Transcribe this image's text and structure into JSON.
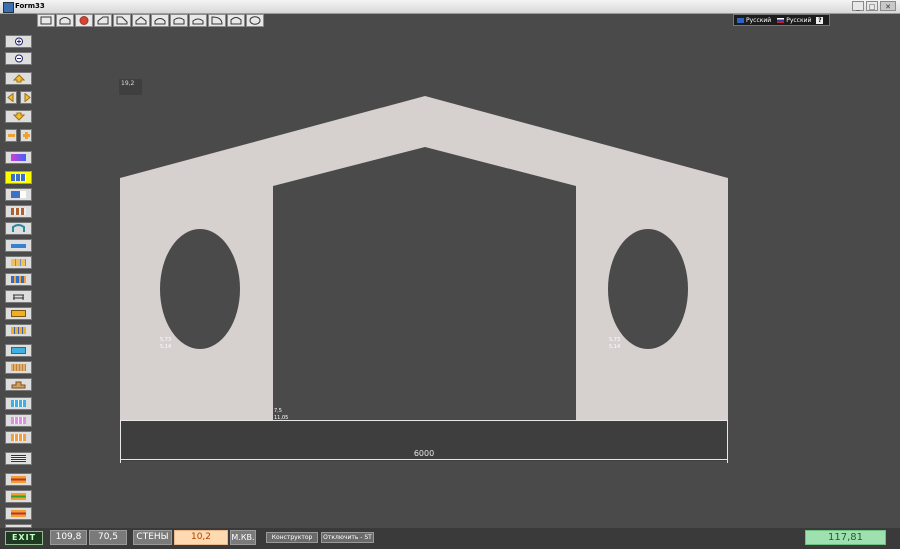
{
  "window": {
    "title": "Form33",
    "min_glyph": "_",
    "max_glyph": "□",
    "close_glyph": "✕"
  },
  "shapes_toolbar": [
    "rect-icon",
    "arch-icon",
    "circle-icon",
    "slope-icon",
    "bevel-icon",
    "peak-icon",
    "arch2-icon",
    "dome-icon",
    "dome2-icon",
    "quarter-icon",
    "dome3-icon",
    "oval-icon"
  ],
  "language": {
    "left": "Русский",
    "right": "Русский",
    "help": "?"
  },
  "canvas": {
    "chip_label": "19,2",
    "left_window_labels": [
      "5,73",
      "5,14"
    ],
    "right_window_labels": [
      "5,73",
      "5,14"
    ],
    "door_labels": [
      "7,5",
      "11,05"
    ],
    "dimension": "6000"
  },
  "statusbar": {
    "exit": "EXIT",
    "coord_x": "109,8",
    "coord_y": "70,5",
    "walls_label": "СТЕНЫ",
    "walls_value": "10,2",
    "unit": "М.КВ.",
    "constructor_button": "Конструктор",
    "disable_button": "Отключить - ST",
    "total": "117,81"
  },
  "colors": {
    "wall": "#d6d0ce",
    "background": "#4a4a4a",
    "active_tool": "#ffff00",
    "total_bg": "#9fe0b0"
  }
}
